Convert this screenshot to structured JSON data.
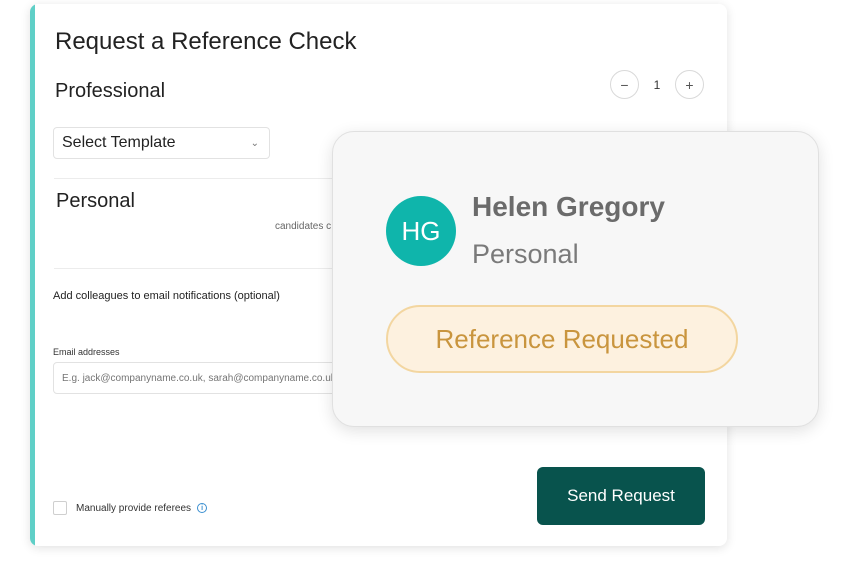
{
  "form": {
    "title": "Request a Reference Check",
    "professional_heading": "Professional",
    "stepper": {
      "minus": "−",
      "value": "1",
      "plus": "+"
    },
    "select_template": "Select Template",
    "personal_heading": "Personal",
    "faint_text": "candidates c",
    "colleagues_label": "Add colleagues to email notifications (optional)",
    "email_label": "Email addresses",
    "email_placeholder": "E.g. jack@companyname.co.uk, sarah@companyname.co.uk",
    "manual_label": "Manually provide referees",
    "send_button": "Send Request"
  },
  "card": {
    "initials": "HG",
    "name": "Helen Gregory",
    "type": "Personal",
    "status": "Reference Requested"
  },
  "colors": {
    "accent": "#5fcfc7",
    "primary_button": "#08534d",
    "avatar": "#0fb5ab",
    "badge_bg": "#fdf1df",
    "badge_border": "#f3d6a0",
    "badge_text": "#c9953e"
  },
  "icons": {
    "select_chevron": "chevron-down-icon",
    "info": "info-icon"
  }
}
